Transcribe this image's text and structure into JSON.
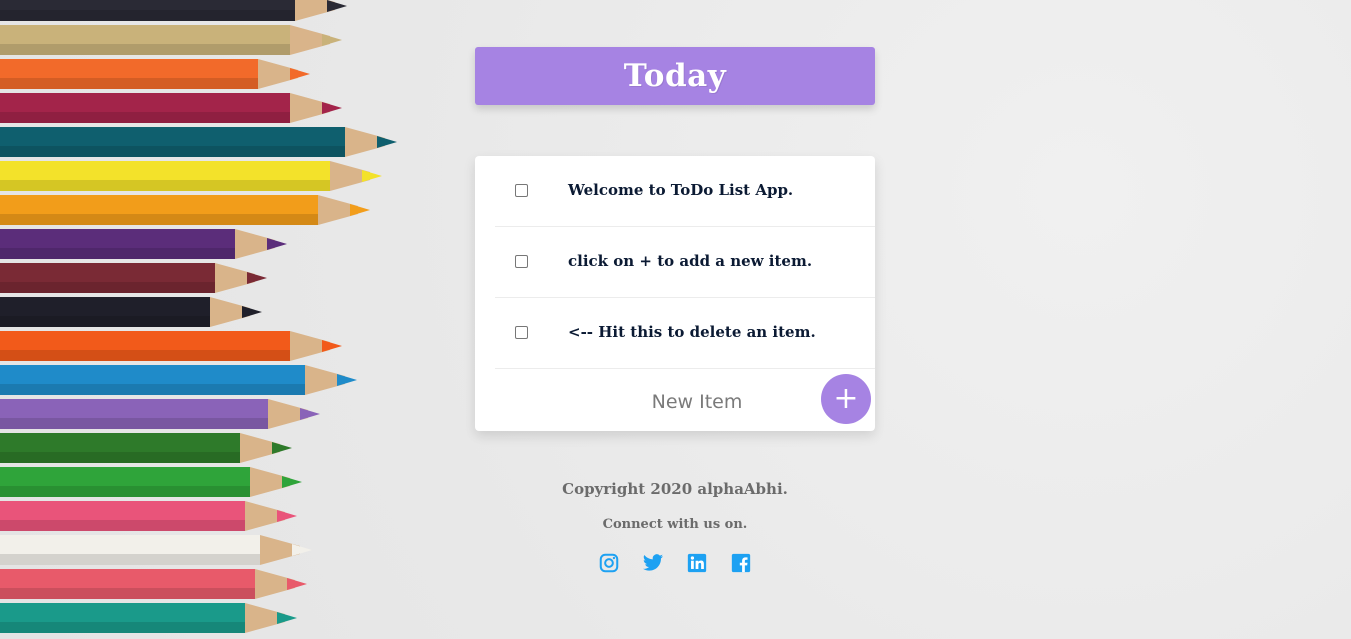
{
  "header": {
    "title": "Today",
    "accent_color": "#a683e3"
  },
  "todos": {
    "items": [
      {
        "text": "Welcome to ToDo List App.",
        "checked": false
      },
      {
        "text": "click on + to add a new item.",
        "checked": false
      },
      {
        "text": "<-- Hit this to delete an item.",
        "checked": false
      }
    ],
    "new_item_placeholder": "New Item",
    "add_button_label": "+"
  },
  "footer": {
    "copyright": "Copyright 2020 alphaAbhi.",
    "connect": "Connect with us on.",
    "socials": [
      {
        "icon": "instagram-icon",
        "color": "#1da1f2"
      },
      {
        "icon": "twitter-icon",
        "color": "#1da1f2"
      },
      {
        "icon": "linkedin-icon",
        "color": "#1da1f2"
      },
      {
        "icon": "facebook-icon",
        "color": "#1da1f2"
      }
    ]
  },
  "background": {
    "decoration": "colored-pencils"
  }
}
